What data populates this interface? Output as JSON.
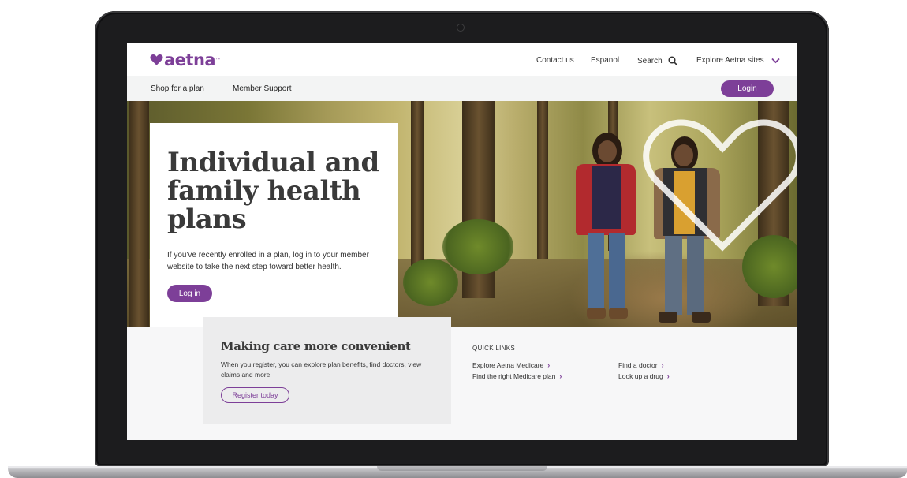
{
  "header": {
    "logo_text": "aetna",
    "logo_tm": "™",
    "utility_nav": {
      "contact": "Contact us",
      "espanol": "Espanol",
      "search": "Search",
      "explore": "Explore Aetna sites"
    }
  },
  "subnav": {
    "shop": "Shop for a plan",
    "member_support": "Member Support",
    "login": "Login"
  },
  "hero": {
    "title": "Individual and family health plans",
    "description": "If you've recently enrolled in a plan, log in to your member website to take the next step toward better health.",
    "button": "Log in"
  },
  "promo": {
    "title": "Making care more convenient",
    "description": "When you register, you can explore plan benefits, find doctors, view claims and more.",
    "button": "Register today"
  },
  "quick_links": {
    "heading": "QUICK LINKS",
    "links": [
      {
        "label": "Explore Aetna Medicare"
      },
      {
        "label": "Find the right Medicare plan"
      },
      {
        "label": "Find a doctor"
      },
      {
        "label": "Look up a drug"
      }
    ]
  },
  "colors": {
    "brand_purple": "#7d3f98",
    "text_dark": "#333333"
  },
  "icons": [
    "heart-logo-icon",
    "search-icon",
    "chevron-down-icon",
    "chevron-right-icon",
    "camera-icon"
  ]
}
